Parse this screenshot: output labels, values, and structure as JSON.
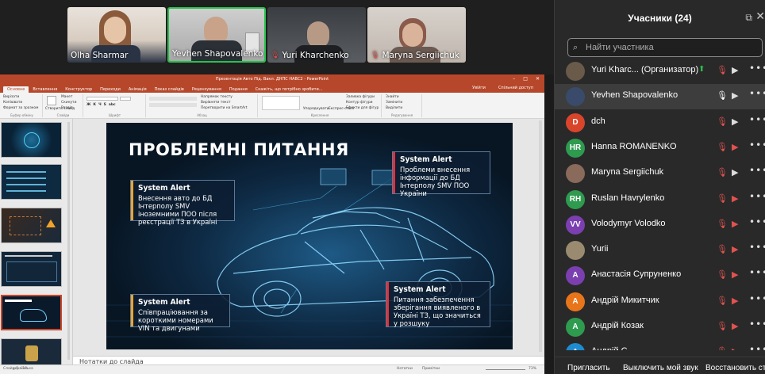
{
  "video": {
    "tiles": [
      {
        "name": "Olha Sharmar",
        "muted": false
      },
      {
        "name": "Yevhen Shapovalenko",
        "muted": false
      },
      {
        "name": "Yuri Kharchenko",
        "muted": true
      },
      {
        "name": "Maryna Sergiichuk",
        "muted": true
      }
    ]
  },
  "ppt": {
    "window_title": "Презентація Авто Під. Вакл. ДНПС НАВС2 - PowerPoint",
    "tabs": [
      "Основне",
      "Вставлення",
      "Конструктор",
      "Переходи",
      "Анімація",
      "Показ слайдів",
      "Рецензування",
      "Подання",
      "Скажіть, що потрібно зробити..."
    ],
    "tabs_right": [
      "Увійти",
      "Спільний доступ"
    ],
    "ribbon": {
      "clipboard_label": "Буфер обміну",
      "slides_label": "Слайди",
      "font_label": "Шрифт",
      "paragraph_label": "Абзац",
      "drawing_label": "Креслення",
      "editing_label": "Редагування",
      "paste": "Вставити",
      "cut": "Вирізати",
      "copy": "Копіювати",
      "format_painter": "Формат за зразком",
      "new_slide": "Створити слайд",
      "layout": "Макет",
      "reset": "Скинути",
      "section": "Розділ",
      "find": "Знайти",
      "replace": "Замінити",
      "select": "Виділити",
      "text_direction": "Напрямок тексту",
      "align_text": "Вирівняти текст",
      "smartart": "Перетворити на SmartArt",
      "arrange": "Упорядкувати",
      "quick_styles": "Експрес-стилі",
      "shape_fill": "Заливка фігури",
      "shape_outline": "Контур фігури",
      "shape_effects": "Ефекти для фігур"
    },
    "notes_placeholder": "Нотатки до слайда",
    "status": {
      "slide": "Слайд 5 з 18",
      "language": "українська",
      "notes": "Нотатки",
      "comments": "Примітки",
      "zoom": "73%"
    }
  },
  "slide": {
    "title": "ПРОБЛЕМНІ ПИТАННЯ",
    "alerts": [
      {
        "heading": "System Alert",
        "body": "Внесення авто до БД Інтерполу SMV іноземними ПОО після реєстрації ТЗ в Україні",
        "color": "#f0a32a"
      },
      {
        "heading": "System Alert",
        "body": "Співпраціювання за короткими номерами VIN та двигунами",
        "color": "#f0a32a"
      },
      {
        "heading": "System Alert",
        "body": "Проблеми внесення інформації до БД Інтерполу SMV ПОО України",
        "color": "#e0303a"
      },
      {
        "heading": "System Alert",
        "body": "Питання забезпечення зберігання виявленого в Україні ТЗ, що значиться у розшуку",
        "color": "#e0303a"
      }
    ]
  },
  "panel": {
    "title": "Учасники (24)",
    "search_placeholder": "Найти участника",
    "participants": [
      {
        "name": "Yuri Kharc...  (Организатор)",
        "initials": "",
        "avatar_color": "#6a5a4a",
        "mic_on": false,
        "cam_on": true,
        "sharing": true
      },
      {
        "name": "Yevhen Shapovalenko",
        "initials": "",
        "avatar_color": "#3a4a6a",
        "mic_on": true,
        "cam_on": true,
        "sharing": false
      },
      {
        "name": "dch",
        "initials": "D",
        "avatar_color": "#d9452b",
        "mic_on": false,
        "cam_on": true,
        "sharing": false
      },
      {
        "name": "Hanna ROMANENKO",
        "initials": "HR",
        "avatar_color": "#2e9b4f",
        "mic_on": false,
        "cam_on": false,
        "sharing": false
      },
      {
        "name": "Maryna Sergiichuk",
        "initials": "",
        "avatar_color": "#8a6a5a",
        "mic_on": false,
        "cam_on": true,
        "sharing": false
      },
      {
        "name": "Ruslan Havrylenko",
        "initials": "RH",
        "avatar_color": "#2e9b4f",
        "mic_on": false,
        "cam_on": false,
        "sharing": false
      },
      {
        "name": "Volodymyr Volodko",
        "initials": "VV",
        "avatar_color": "#7b3fb0",
        "mic_on": false,
        "cam_on": false,
        "sharing": false
      },
      {
        "name": "Yurii",
        "initials": "",
        "avatar_color": "#9a8a70",
        "mic_on": false,
        "cam_on": false,
        "sharing": false
      },
      {
        "name": "Анастасія Супруненко",
        "initials": "А",
        "avatar_color": "#7b3fb0",
        "mic_on": false,
        "cam_on": false,
        "sharing": false
      },
      {
        "name": "Андрій  Микитчик",
        "initials": "А",
        "avatar_color": "#e8751a",
        "mic_on": false,
        "cam_on": false,
        "sharing": false
      },
      {
        "name": "Андрій Козак",
        "initials": "А",
        "avatar_color": "#2e9b4f",
        "mic_on": false,
        "cam_on": false,
        "sharing": false
      },
      {
        "name": "Андрій С...",
        "initials": "А",
        "avatar_color": "#1f8bd0",
        "mic_on": false,
        "cam_on": false,
        "sharing": false
      }
    ],
    "footer": {
      "invite": "Пригласить",
      "mute_me": "Выключить мой звук",
      "restore": "Восстановить ст"
    }
  }
}
